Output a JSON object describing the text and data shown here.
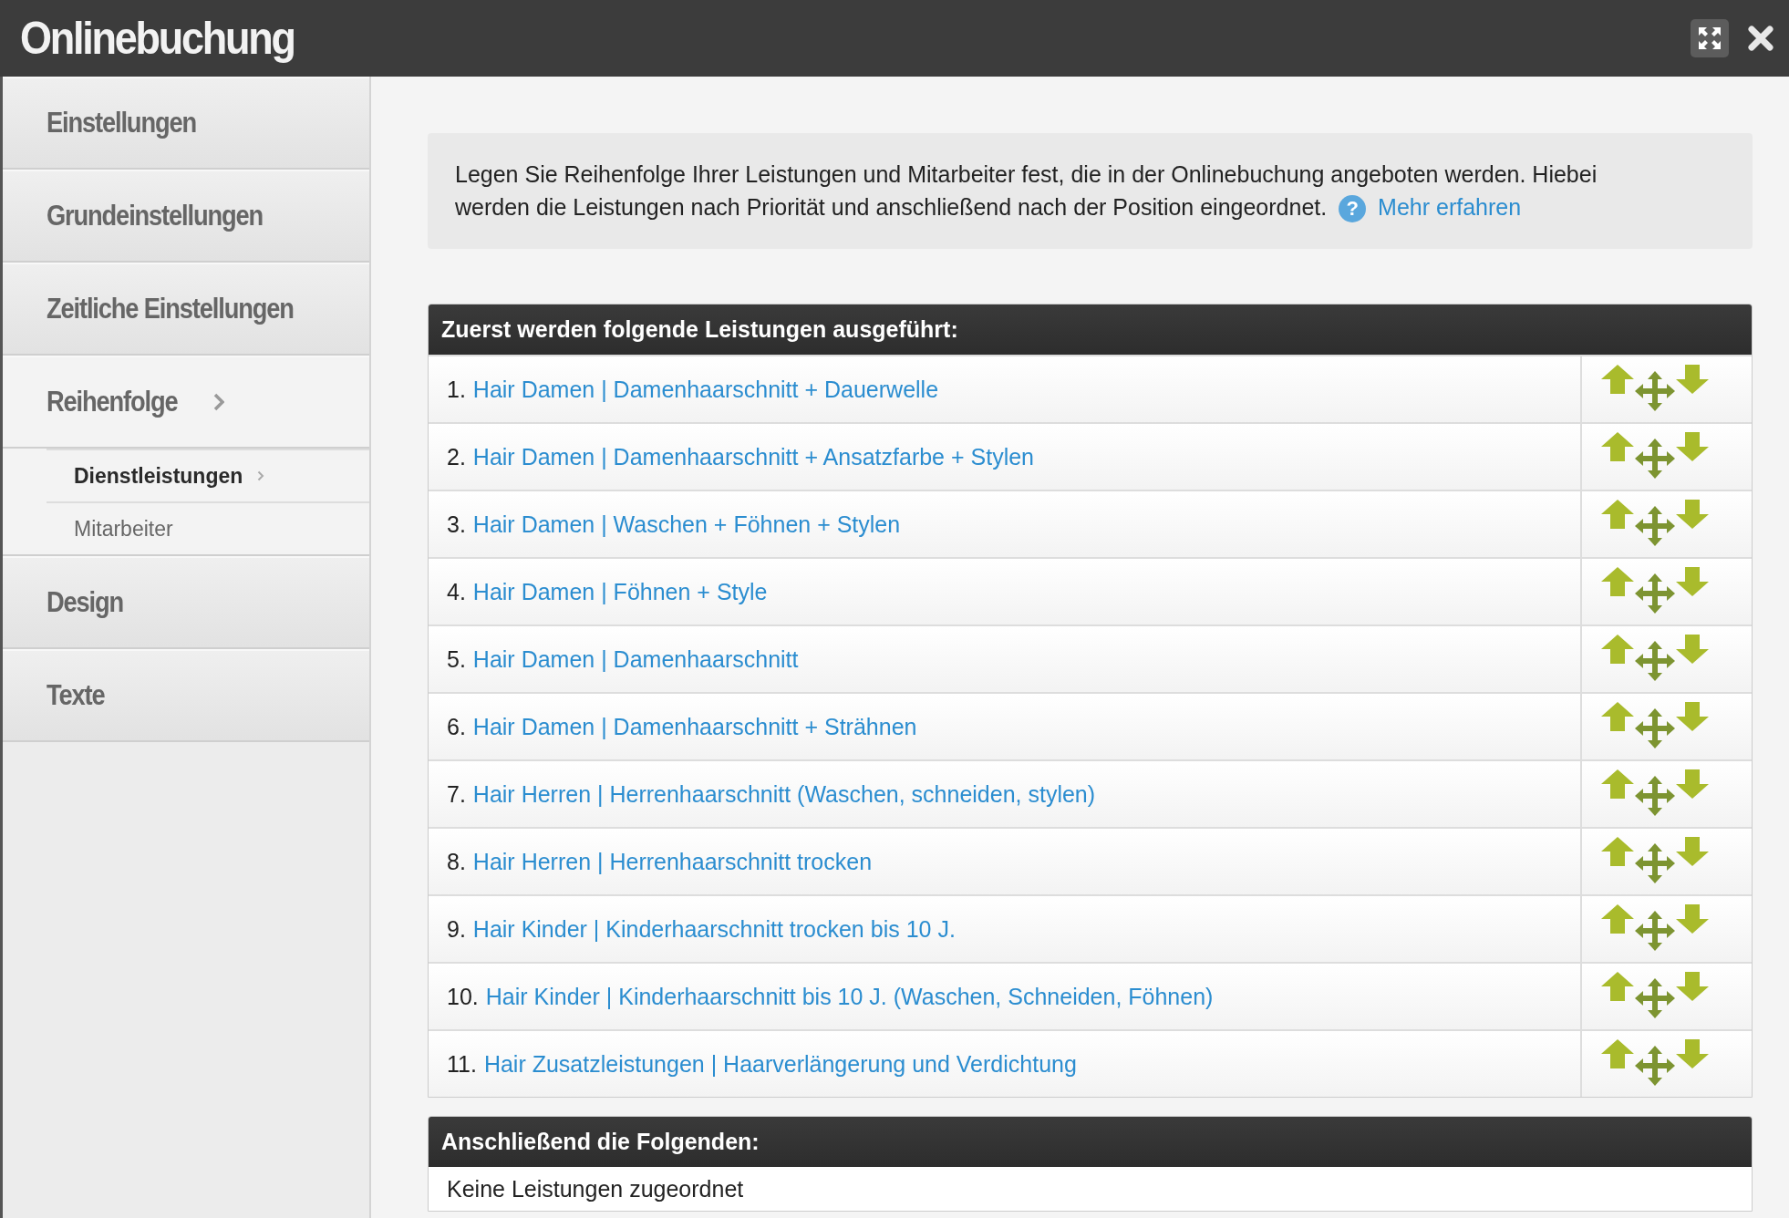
{
  "window": {
    "title": "Onlinebuchung"
  },
  "sidebar": {
    "items": [
      {
        "label": "Einstellungen",
        "selected": false
      },
      {
        "label": "Grundeinstellungen",
        "selected": false
      },
      {
        "label": "Zeitliche Einstellungen",
        "selected": false
      },
      {
        "label": "Reihenfolge",
        "selected": true,
        "children": [
          {
            "label": "Dienstleistungen",
            "selected": true
          },
          {
            "label": "Mitarbeiter",
            "selected": false
          }
        ]
      },
      {
        "label": "Design",
        "selected": false
      },
      {
        "label": "Texte",
        "selected": false
      }
    ]
  },
  "info": {
    "text": "Legen Sie Reihenfolge Ihrer Leistungen und Mitarbeiter fest, die in der Onlinebuchung angeboten werden. Hiebei werden die Leistungen nach Priorität und anschließend nach der Position eingeordnet.",
    "help_icon": "?",
    "link": "Mehr erfahren"
  },
  "first_table": {
    "title": "Zuerst werden folgende Leistungen ausgeführt:",
    "rows": [
      {
        "number": "1.",
        "service": "Hair Damen | Damenhaarschnitt + Dauerwelle"
      },
      {
        "number": "2.",
        "service": "Hair Damen | Damenhaarschnitt + Ansatzfarbe + Stylen"
      },
      {
        "number": "3.",
        "service": "Hair Damen | Waschen + Föhnen + Stylen"
      },
      {
        "number": "4.",
        "service": "Hair Damen | Föhnen + Style"
      },
      {
        "number": "5.",
        "service": "Hair Damen | Damenhaarschnitt"
      },
      {
        "number": "6.",
        "service": "Hair Damen | Damenhaarschnitt + Strähnen"
      },
      {
        "number": "7.",
        "service": "Hair Herren | Herrenhaarschnitt (Waschen, schneiden, stylen)"
      },
      {
        "number": "8.",
        "service": "Hair Herren | Herrenhaarschnitt trocken"
      },
      {
        "number": "9.",
        "service": "Hair Kinder | Kinderhaarschnitt trocken bis 10 J."
      },
      {
        "number": "10.",
        "service": "Hair Kinder | Kinderhaarschnitt bis 10 J. (Waschen, Schneiden, Föhnen)"
      },
      {
        "number": "11.",
        "service": "Hair Zusatzleistungen | Haarverlängerung und Verdichtung"
      }
    ]
  },
  "second_table": {
    "title": "Anschließend die Folgenden:",
    "empty_text": "Keine Leistungen zugeordnet"
  }
}
